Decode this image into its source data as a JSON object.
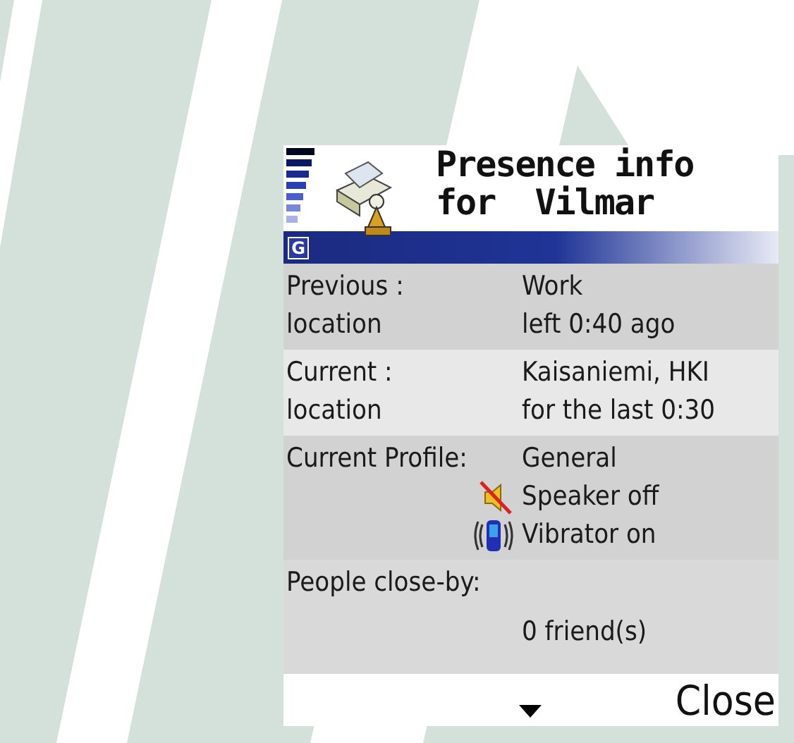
{
  "header": {
    "title_lines": [
      "Presence info",
      "for  Vilmar"
    ],
    "network_indicator": "G"
  },
  "rows": [
    {
      "kind": "pair",
      "label_lines": [
        "Previous :",
        "location"
      ],
      "value_lines": [
        "Work",
        "left 0:40 ago"
      ]
    },
    {
      "kind": "pair",
      "label_lines": [
        "Current :",
        "location"
      ],
      "value_lines": [
        "Kaisaniemi, HKI",
        "for the last 0:30"
      ]
    },
    {
      "kind": "profile",
      "label": "Current Profile:",
      "value": "General",
      "settings": [
        {
          "kind": "speaker",
          "text": "Speaker off",
          "on": false
        },
        {
          "kind": "vibrator",
          "text": "Vibrator on",
          "on": true
        }
      ]
    },
    {
      "kind": "people",
      "label": "People close-by:",
      "value": "0 friend(s)"
    }
  ],
  "softkeys": {
    "right": "Close"
  }
}
